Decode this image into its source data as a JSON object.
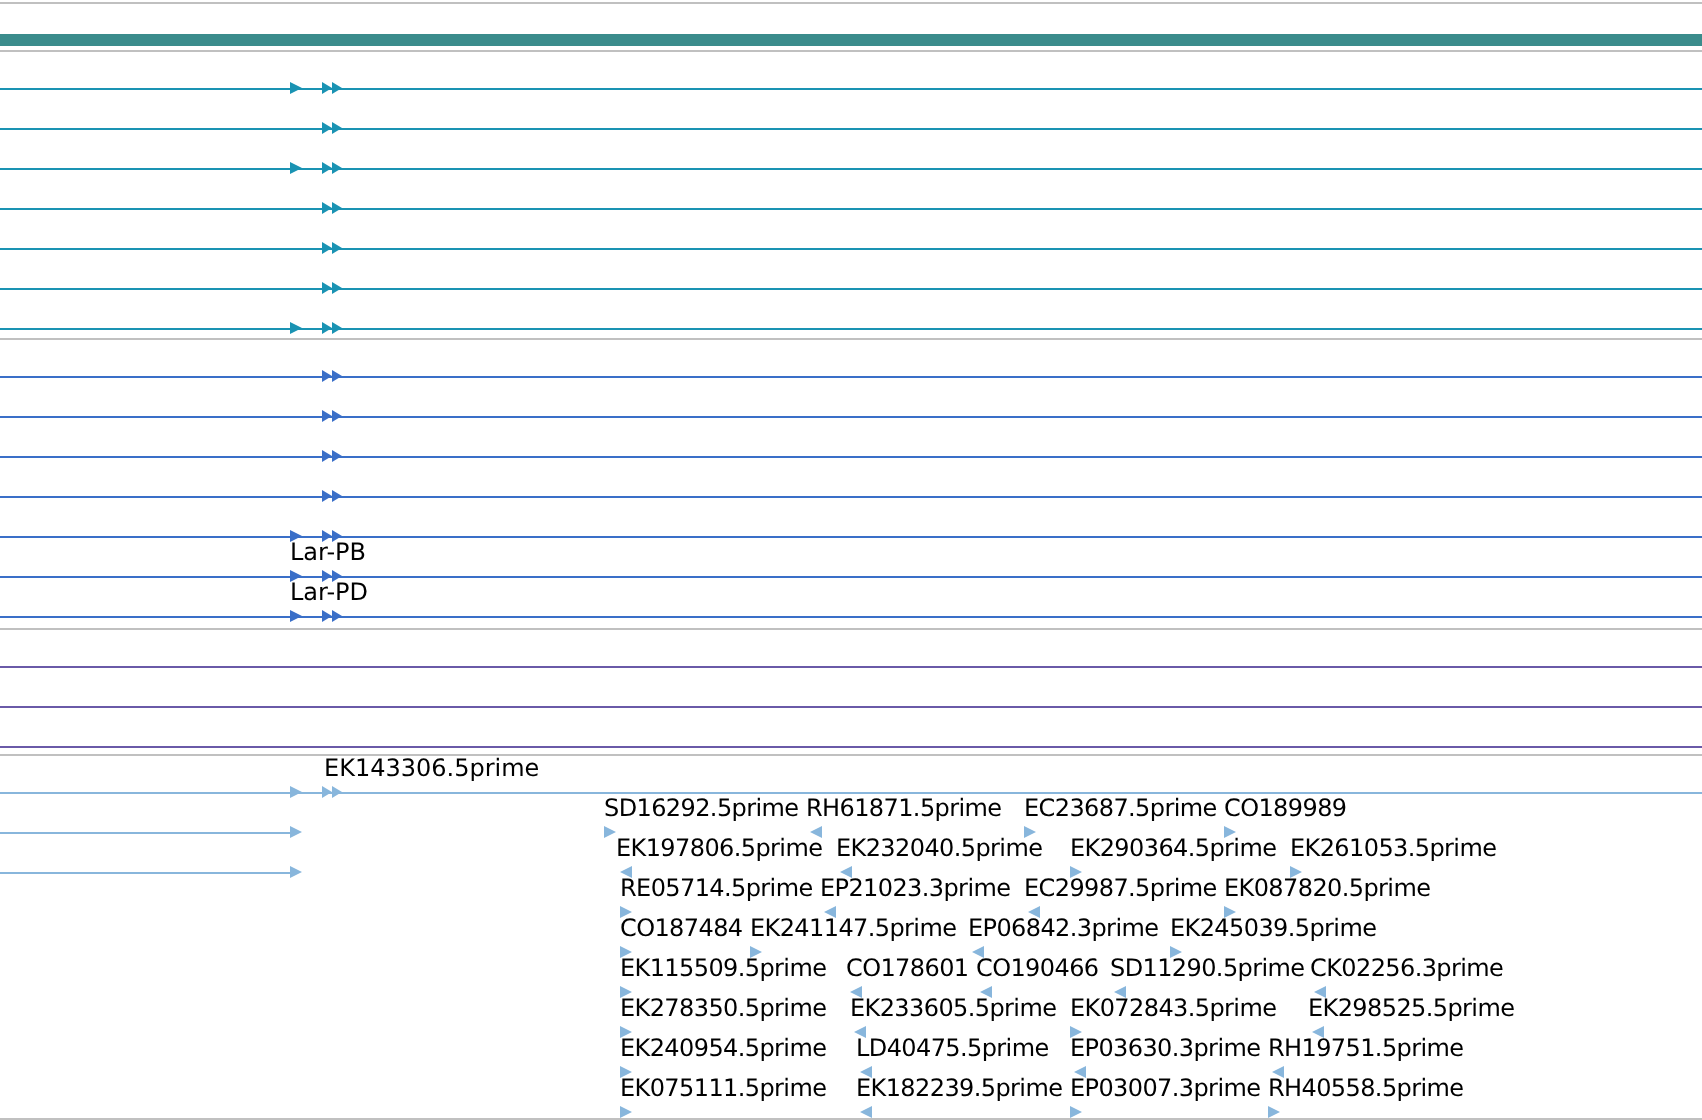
{
  "tracks": [
    {
      "color": "#1a93b3",
      "rows": [
        {
          "kind": "full",
          "start_arrow": true,
          "double_arrow": true
        },
        {
          "kind": "full",
          "start_arrow": false,
          "double_arrow": true
        },
        {
          "kind": "full",
          "start_arrow": true,
          "double_arrow": true
        },
        {
          "kind": "full",
          "start_arrow": false,
          "double_arrow": true
        },
        {
          "kind": "full",
          "start_arrow": false,
          "double_arrow": true
        },
        {
          "kind": "full",
          "start_arrow": false,
          "double_arrow": true
        },
        {
          "kind": "full",
          "start_arrow": true,
          "double_arrow": true
        }
      ]
    },
    {
      "color": "#3a6fc8",
      "rows": [
        {
          "kind": "full",
          "start_arrow": false,
          "double_arrow": true
        },
        {
          "kind": "full",
          "start_arrow": false,
          "double_arrow": true
        },
        {
          "kind": "full",
          "start_arrow": false,
          "double_arrow": true
        },
        {
          "kind": "full",
          "start_arrow": false,
          "double_arrow": true
        },
        {
          "kind": "full",
          "start_arrow": true,
          "double_arrow": true
        },
        {
          "label": "Lar-PB",
          "kind": "full",
          "start_arrow": true,
          "double_arrow": true
        },
        {
          "label": "Lar-PD",
          "kind": "full",
          "start_arrow": true,
          "double_arrow": true
        }
      ]
    },
    {
      "color": "#6a5aa8",
      "rows": [
        {
          "kind": "full",
          "start_arrow": false,
          "double_arrow": false
        },
        {
          "kind": "full",
          "start_arrow": false,
          "double_arrow": false
        },
        {
          "kind": "full",
          "start_arrow": false,
          "double_arrow": false
        }
      ]
    },
    {
      "color": "#88b6dc",
      "rows": [
        {
          "label": "EK143306.5prime",
          "kind": "full",
          "start_arrow": true,
          "double_arrow": true
        },
        {
          "kind": "partial",
          "start_arrow": true,
          "double_arrow": false,
          "features": [
            {
              "label": "SD16292.5prime",
              "reverse": false
            },
            {
              "label": "RH61871.5prime",
              "reverse": true
            },
            {
              "label": "EC23687.5prime",
              "reverse": false
            },
            {
              "label": "CO189989",
              "reverse": false
            }
          ]
        },
        {
          "kind": "partial",
          "start_arrow": true,
          "double_arrow": false,
          "features": [
            {
              "label": "EK197806.5prime",
              "reverse": true
            },
            {
              "label": "EK232040.5prime",
              "reverse": true
            },
            {
              "label": "EK290364.5prime",
              "reverse": false
            },
            {
              "label": "EK261053.5prime",
              "reverse": false
            }
          ]
        },
        {
          "kind": "blank",
          "start_arrow": false,
          "double_arrow": false,
          "features": [
            {
              "label": "RE05714.5prime",
              "reverse": false
            },
            {
              "label": "EP21023.3prime",
              "reverse": true
            },
            {
              "label": "EC29987.5prime",
              "reverse": true
            },
            {
              "label": "EK087820.5prime",
              "reverse": false
            }
          ]
        },
        {
          "kind": "blank",
          "start_arrow": false,
          "double_arrow": false,
          "features": [
            {
              "label": "CO187484",
              "reverse": false
            },
            {
              "label": "EK241147.5prime",
              "reverse": false
            },
            {
              "label": "EP06842.3prime",
              "reverse": true
            },
            {
              "label": "EK245039.5prime",
              "reverse": false
            }
          ]
        },
        {
          "kind": "blank",
          "start_arrow": false,
          "double_arrow": false,
          "features": [
            {
              "label": "EK115509.5prime",
              "reverse": false
            },
            {
              "label": "CO178601",
              "reverse": true
            },
            {
              "label": "CO190466",
              "reverse": true
            },
            {
              "label": "SD11290.5prime",
              "reverse": true
            },
            {
              "label": "CK02256.3prime",
              "reverse": true
            }
          ]
        },
        {
          "kind": "blank",
          "start_arrow": false,
          "double_arrow": false,
          "features": [
            {
              "label": "EK278350.5prime",
              "reverse": false
            },
            {
              "label": "EK233605.5prime",
              "reverse": true
            },
            {
              "label": "EK072843.5prime",
              "reverse": false
            },
            {
              "label": "EK298525.5prime",
              "reverse": true
            }
          ]
        },
        {
          "kind": "blank",
          "start_arrow": false,
          "double_arrow": false,
          "features": [
            {
              "label": "EK240954.5prime",
              "reverse": false
            },
            {
              "label": "LD40475.5prime",
              "reverse": true
            },
            {
              "label": "EP03630.3prime",
              "reverse": true
            },
            {
              "label": "RH19751.5prime",
              "reverse": true
            }
          ]
        },
        {
          "kind": "blank",
          "start_arrow": false,
          "double_arrow": false,
          "features": [
            {
              "label": "EK075111.5prime",
              "reverse": false
            },
            {
              "label": "EK182239.5prime",
              "reverse": true
            },
            {
              "label": "EP03007.3prime",
              "reverse": false
            },
            {
              "label": "RH40558.5prime",
              "reverse": false
            }
          ]
        }
      ]
    }
  ]
}
